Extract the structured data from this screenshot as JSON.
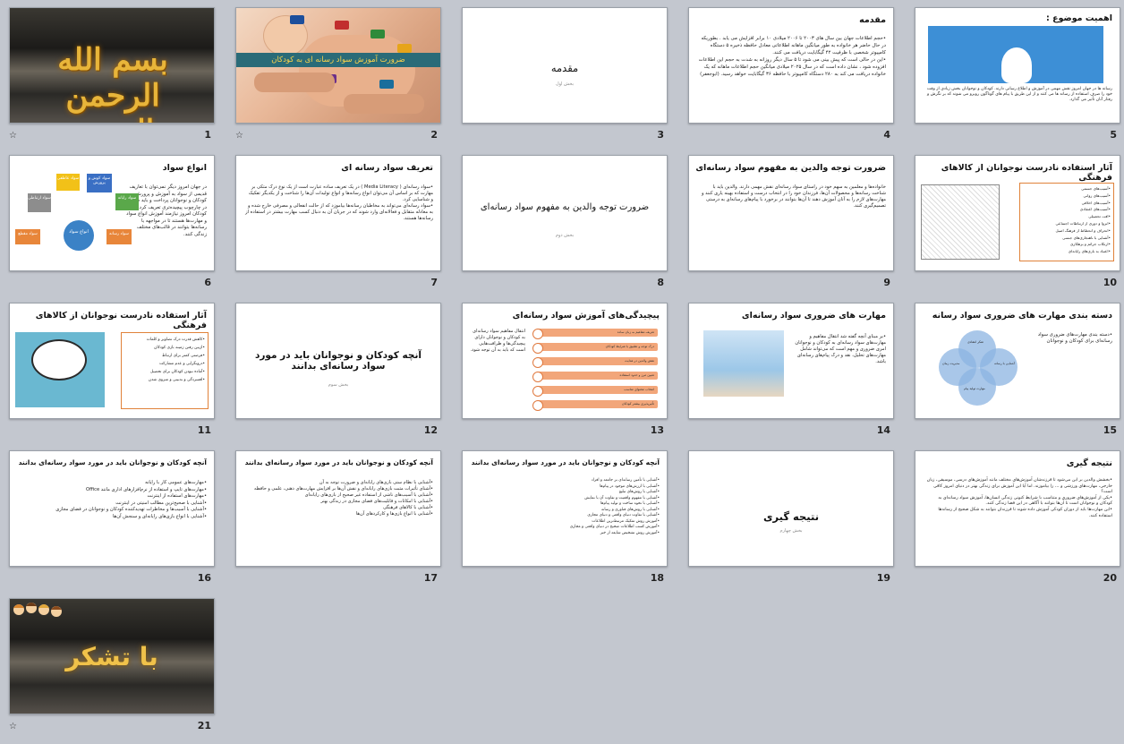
{
  "slides": [
    {
      "number": "1",
      "star": "☆",
      "calligraphy": "بسم الله الرحمن الرحیم"
    },
    {
      "number": "2",
      "star": "☆",
      "banner": "ضرورت آموزش سواد رسانه ای به کودکان"
    },
    {
      "number": "3",
      "title": "مقدمه",
      "subtitle": "بخش اول"
    },
    {
      "number": "4",
      "title": "مقدمه",
      "bullets": [
        "حجم اطلاعات جهان بین سال های ۲۰۰۳ تا ۲۰۰۶ میلادی ۱۰ برابر افزایش می یابد . بطوریکه در حال حاضر هر خانواده به طور میانگین ماهانه اطلاعاتی معادل حافظه ذخیره ۵ دستگاه کامپیوتر شخصی با ظرفیت ۴۲ گیگابایت دریافت می کنند.",
        "این در حالی است که پیش بینی می شود تا ۵ سال دیگر روزانه به شدت به حجم این اطلاعات افزوده شود ، نشان داده است که در سال ۲۰۲۵ میلادی میانگین حجم اطلاعات ماهانه که یک خانواده دریافت می کند به ۲۸۰ دستگاه کامپیوتر با حافظه ۳۶ گیگابایت خواهد رسید. (ابوجعفر)"
      ]
    },
    {
      "number": "5",
      "title": "اهمیت موضوع :",
      "text": "رسانه ها در جهان امروز نقش مهمی در آموزش و اطلاع رسانی دارند. کودکان و نوجوانان بخش زیادی از وقت خود را صرف استفاده از رسانه ها می کنند و از این طریق با پیام های گوناگون روبرو می شوند که بر نگرش و رفتار آنان تأثیر می گذارد."
    },
    {
      "number": "6",
      "title": "انواع سواد",
      "text": "در جهان امروز دیگر نمی‌توان با تعاریف قدیمی از سواد به آموزش و پرورش کودکان و نوجوانان پرداخت و باید سواد را در چارچوب پیچیده‌تری تعریف کرد. کودکان امروز نیازمند آموزش انواع سواد و مهارت‌ها هستند تا در مواجهه با رسانه‌ها بتوانند در قالب‌های مختلف زندگی کنند.",
      "hub": "انواع سواد",
      "boxes": [
        "سواد عاطفی",
        "سواد کوش و پرورش",
        "سواد رایانه",
        "سواد ارتباطی",
        "سواد رسانه",
        "سواد مقطع"
      ]
    },
    {
      "number": "7",
      "title": "تعریف سواد رسانه ای",
      "bullets": [
        "سواد رسانه‌ای ( Media Literacy ) در یک تعریف ساده عبارت است از یک نوع درک متکی بر مهارت که بر اساس آن می‌توان انواع رسانه‌ها و انواع تولیدات آن‌ها را شناخت و از یکدیگر تفکیک و شناسایی کرد.",
        "سواد رسانه‌ای می‌تواند به مخاطبان رسانه‌ها بیاموزد که از حالت انفعالی و مصرفی خارج شده و به معادله متقابل و فعالانه‌ای وارد شوند که در جریان آن به دنبال کسب مهارت بیشتر در استفاده از رسانه‌ها هستند."
      ]
    },
    {
      "number": "8",
      "title": "ضرورت توجه والدین به مفهوم سواد رسانه‌ای",
      "subtitle": "بخش دوم"
    },
    {
      "number": "9",
      "title": "ضرورت توجه والدین به مفهوم سواد رسانه‌ای",
      "text": "خانواده‌ها و معلمین به سهم خود در راستای سواد رسانه‌ای نقش مهمی دارند. والدین باید با شناخت رسانه‌ها و محصولات آن‌ها، فرزندان خود را در انتخاب درست و استفاده بهینه یاری کنند و مهارت‌های لازم را به آنان آموزش دهند تا آن‌ها بتوانند در برخورد با پیام‌های رسانه‌ای به درستی تصمیم‌گیری کنند."
    },
    {
      "number": "10",
      "title": "آثار استفاده نادرست نوجوانان از کالاهای فرهنگی",
      "bullets": [
        "آسیب‌های جسمی",
        "آسیب‌های روانی",
        "آسیب‌های اخلاقی",
        "آسیب‌های اعتقادی",
        "افت تحصیلی",
        "انزوا و دوری از ارتباطات اجتماعی",
        "انحراف و انحطاط از فرهنگ اصیل",
        "آشنایی با ناهنجاری‌های جنسی",
        "ارتکاب جرائم و بزهکاری",
        "اعتیاد به بازی‌های رایانه‌ای"
      ]
    },
    {
      "number": "11",
      "title": "آثار استفاده نادرست نوجوانان از کالاهای فرهنگی",
      "bullets": [
        "کاهش قدرت درک تصاویر و کلمات",
        "ازبین رفتن زمینه بازی کودکان",
        "فرصتی کمتر برای ارتباط",
        "درونگرایی و عدم مشارکت",
        "آماده نبودن کودکان برای تحصیل",
        "افسردگی و بدبینی و منزوی شدن"
      ]
    },
    {
      "number": "12",
      "title": "آنچه کودکان و نوجوانان باید در مورد سواد رسانه‌ای بدانند",
      "subtitle": "بخش سوم"
    },
    {
      "number": "13",
      "title": "پیچیدگی‌های آموزش سواد رسانه‌ای",
      "text": "انتقال مفاهیم سواد رسانه‌ای به کودکان و نوجوانان دارای پیچیدگی‌ها و ظرافت‌هایی است که باید به آن توجه شود.",
      "rows": [
        "تعریف مفاهیم به زبان ساده",
        "درک توجه و تطبیق با شرایط کودکان",
        "نقش والدین در هدایت",
        "تعیین مرز و حدود استفاده",
        "انتخاب محتوای مناسب",
        "تأثیرپذیری بیشتر کودکان"
      ]
    },
    {
      "number": "14",
      "title": "مهارت های ضروری سواد رسانه‌ای",
      "bullets": [
        "بر مبنای آنچه گفته شد انتقال مفاهیم و مهارت‌های سواد رسانه‌ای به کودکان و نوجوانان امری ضروری و مهم است که می‌تواند شامل مهارت‌های تحلیل، نقد و درک پیام‌های رسانه‌ای باشد."
      ]
    },
    {
      "number": "15",
      "title": "دسته بندی مهارت های ضروری سواد رسانه",
      "bullets": [
        "دسته بندی مهارت‌های ضروری سواد رسانه‌ای برای کودکان و نوجوانان"
      ],
      "venn": [
        "تفکر انتقادی",
        "آشنایی با رسانه",
        "مهارت تولید پیام",
        "مدیریت زمان"
      ]
    },
    {
      "number": "16",
      "title": "آنچه کودکان و نوجوانان باید در مورد سواد رسانه‌ای بدانند",
      "bullets": [
        "مهارت‌های عمومی کار با رایانه",
        "مهارت‌های تایپ و استفاده از نرم‌افزارهای اداری مانند Office",
        "مهارت‌های استفاده از اینترنت",
        "آشنایی با صحیح‌ترین مطالب امنیتی در اینترنت",
        "آشنایی با آسیب‌ها و مخاطرات تهدیدکننده کودکان و نوجوانان در فضای مجازی",
        "آشنایی با انواع بازی‌های رایانه‌ای و سنجش آن‌ها"
      ]
    },
    {
      "number": "17",
      "title": "آنچه کودکان و نوجوانان باید در مورد سواد رسانه‌ای بدانند",
      "bullets": [
        "آشنایی با نظام ستی بازی‌های رایانه‌ای و ضرورت توجه به آن",
        "آشنای تأثیرات مثبت بازی‌های رایانه‌ای و نقش آن‌ها بر افزایش مهارت‌های ذهنی، علمی و حافظه",
        "آشنایی با آسیب‌های ناشی از استفاده غیر صحیح از بازی‌های رایانه‌ای",
        "آشنایی با امکانات و قابلیت‌های فضای مجازی در زندگی بهتر",
        "آشنایی با کالاهای فرهنگی",
        "آشنایی با انواع بازی‌ها و کارکردهای آن‌ها"
      ]
    },
    {
      "number": "18",
      "title": "آنچه کودکان و نوجوانان باید در مورد سواد رسانه‌ای بدانند",
      "bullets": [
        "آشنایی با تأمین رسانه‌ای بر جامعه و افراد",
        "آشنایی با ارزش‌های موجود در پیام‌ها",
        "آشنایی با روش‌های تبلیغ",
        "آشنایی با مفهوم واقعیت و تفاوت آن با نمایش",
        "آشنایی با نحوه ساخت و تولید پیام‌ها",
        "آشنایی با روش‌های فناوری و رسانه",
        "آشنایی با تفاوت دنیای واقعی و دنیای مجازی",
        "آموزش روش تفکیک مرتبط‌ترین اطلاعات",
        "آموزش کسب اطلاعات صحیح در دنیای واقعی و مجازی",
        "آموزش روش تشخیص شایعه از خبر"
      ]
    },
    {
      "number": "19",
      "title": "نتیجه گیری",
      "subtitle": "بخش چهارم"
    },
    {
      "number": "20",
      "title": "نتیجه گیری",
      "bullets": [
        "بخشش والدین بر این می‌شود تا فرزندشان آموزش‌های مختلف مانند آموزش‌های درسی، موسیقی، زبان خارجی، مهارت‌های ورزشی و … را بیاموزند. اما آیا این آموزش برای زندگی بهتر در دنیای امروز کافی است؟",
        "یکی از آموزش‌های ضروری و متناسب با شرایط کنونی زندگی انسان‌ها، آموزش سواد رسانه‌ای به کودکان و نوجوانان است تا آن‌ها بتوانند با آگاهی در این فضا زندگی کنند.",
        "این مهارت‌ها باید از دوران کودکی آموزش داده شوند تا فرزندان بتوانند به شکل صحیح از رسانه‌ها استفاده کنند."
      ]
    },
    {
      "number": "21",
      "star": "☆",
      "thanks": "با تشکر"
    }
  ]
}
